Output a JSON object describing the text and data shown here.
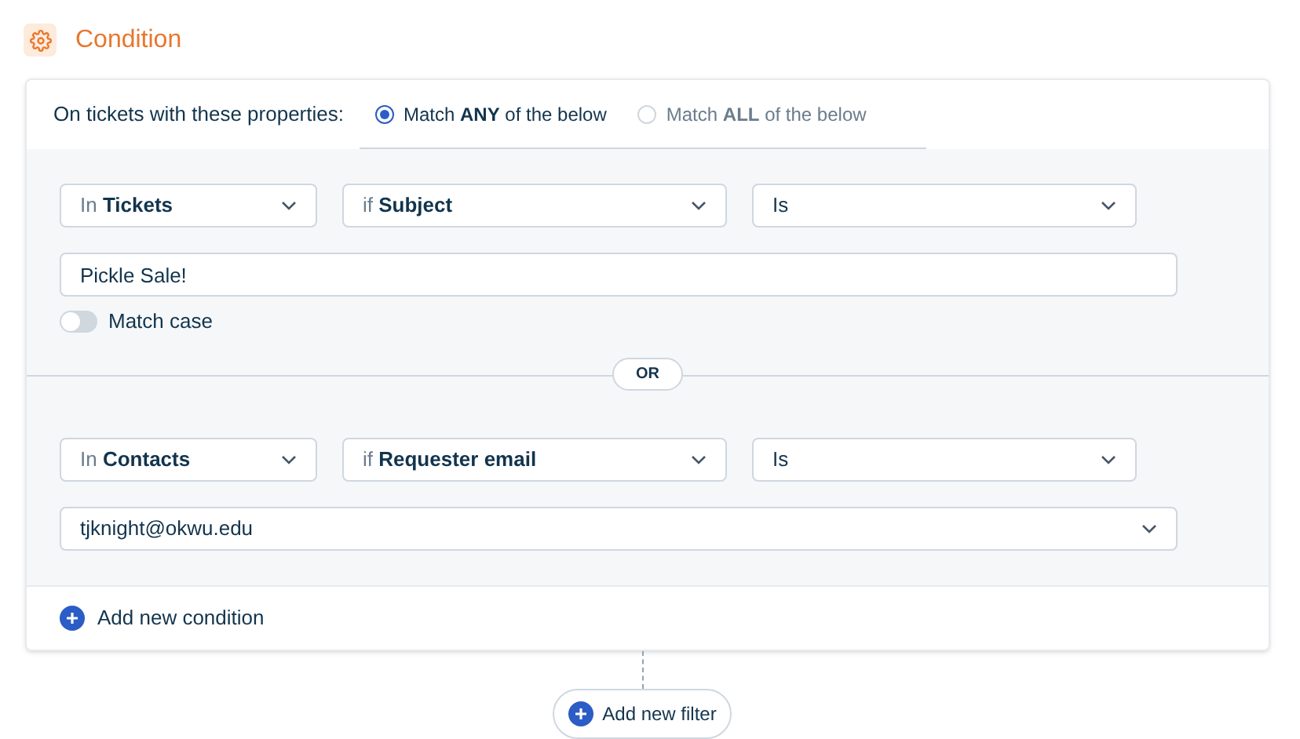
{
  "header": {
    "title": "Condition"
  },
  "match": {
    "label": "On tickets with these properties:",
    "options": [
      {
        "label": "Match **ANY** of the below",
        "selected": true
      },
      {
        "label": "Match **ALL** of the below",
        "selected": false
      }
    ]
  },
  "conditions": [
    {
      "selects": [
        {
          "prefix": "In",
          "value": "Tickets"
        },
        {
          "prefix": "if",
          "value": "Subject"
        },
        {
          "value": "Is"
        }
      ],
      "value": {
        "kind": "text",
        "text": "Pickle Sale!"
      },
      "toggle": {
        "label": "Match case",
        "on": false
      }
    },
    {
      "selects": [
        {
          "prefix": "In",
          "value": "Contacts"
        },
        {
          "prefix": "if",
          "value": "Requester email"
        },
        {
          "value": "Is"
        }
      ],
      "value": {
        "kind": "dropdown",
        "text": "tjknight@okwu.edu"
      }
    }
  ],
  "separator": "OR",
  "add_condition": "Add new condition",
  "add_filter": "Add new filter"
}
